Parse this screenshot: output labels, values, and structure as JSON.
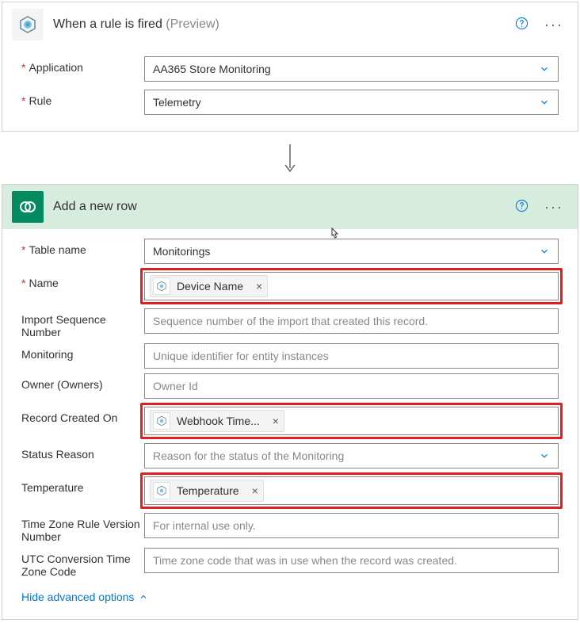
{
  "trigger": {
    "title": "When a rule is fired",
    "preview": "(Preview)",
    "fields": {
      "application": {
        "label": "Application",
        "value": "AA365 Store Monitoring"
      },
      "rule": {
        "label": "Rule",
        "value": "Telemetry"
      }
    }
  },
  "action": {
    "title": "Add a new row",
    "fields": {
      "table_name": {
        "label": "Table name",
        "value": "Monitorings"
      },
      "name": {
        "label": "Name",
        "token": "Device Name"
      },
      "import_seq": {
        "label": "Import Sequence Number",
        "placeholder": "Sequence number of the import that created this record."
      },
      "monitoring": {
        "label": "Monitoring",
        "placeholder": "Unique identifier for entity instances"
      },
      "owner": {
        "label": "Owner (Owners)",
        "placeholder": "Owner Id"
      },
      "record_created": {
        "label": "Record Created On",
        "token": "Webhook Time..."
      },
      "status_reason": {
        "label": "Status Reason",
        "placeholder": "Reason for the status of the Monitoring"
      },
      "temperature": {
        "label": "Temperature",
        "token": "Temperature"
      },
      "tz_rule": {
        "label": "Time Zone Rule Version Number",
        "placeholder": "For internal use only."
      },
      "utc_conv": {
        "label": "UTC Conversion Time Zone Code",
        "placeholder": "Time zone code that was in use when the record was created."
      }
    },
    "hide_advanced": "Hide advanced options"
  }
}
